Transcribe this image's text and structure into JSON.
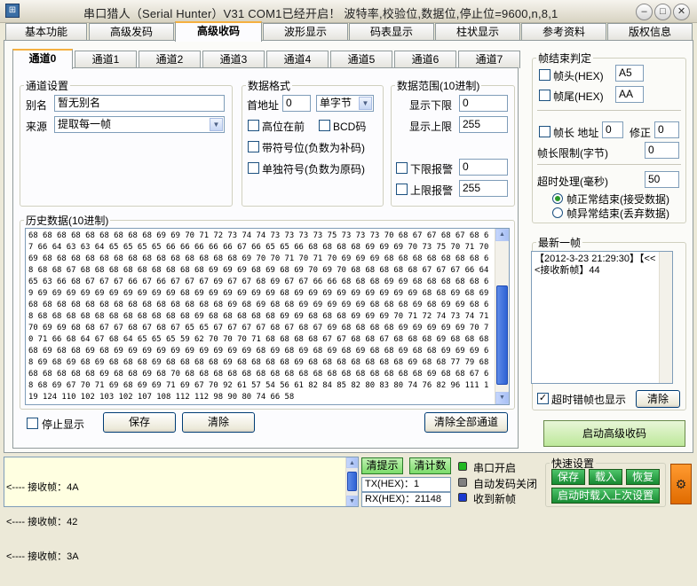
{
  "window": {
    "title": "串口猎人（Serial Hunter）V31    COM1已经开启！ 波特率,校验位,数据位,停止位=9600,n,8,1",
    "icon": "app-icon",
    "min_glyph": "–",
    "max_glyph": "□",
    "close_glyph": "✕"
  },
  "main_tabs": [
    "基本功能",
    "高级发码",
    "高级收码",
    "波形显示",
    "码表显示",
    "柱状显示",
    "参考资料",
    "版权信息"
  ],
  "active_main_tab": "高级收码",
  "channel_tabs": [
    "通道0",
    "通道1",
    "通道2",
    "通道3",
    "通道4",
    "通道5",
    "通道6",
    "通道7"
  ],
  "active_channel_tab": "通道0",
  "channel_settings": {
    "legend": "通道设置",
    "alias_label": "别名",
    "alias_value": "暂无别名",
    "source_label": "来源",
    "source_value": "提取每一帧"
  },
  "data_format": {
    "legend": "数据格式",
    "first_addr_label": "首地址",
    "first_addr_value": "0",
    "byte_value": "单字节",
    "high_first": "高位在前",
    "bcd": "BCD码",
    "signed": "带符号位(负数为补码)",
    "single_sign": "单独符号(负数为原码)"
  },
  "data_range": {
    "legend": "数据范围(10进制)",
    "lower_label": "显示下限",
    "lower_value": "0",
    "upper_label": "显示上限",
    "upper_value": "255",
    "lower_alarm_label": "下限报警",
    "lower_alarm_value": "0",
    "upper_alarm_label": "上限报警",
    "upper_alarm_value": "255"
  },
  "history": {
    "legend": "历史数据(10进制)",
    "data": "68 68 68 68 68 68 68 68 68 69 69 70 71 72 73 74 74 73 73 73 73 75 73 73 73 70 68 67 67 68 67 68 67 66 64 63 63 64 65 65 65 65 66 66 66 66 66 67 66 65 65 66 68 68 68 68 69 69 69 70 73 75 70 71 70 69 68 68 68 68 68 68 68 68 68 68 68 68 68 68 69 70 70 71 70 71 70 69 69 69 68 68 68 68 68 68 68 68 68 68 67 68 68 68 68 68 68 68 68 68 69 69 69 68 69 68 69 70 69 70 68 68 68 68 68 67 67 67 66 64 65 63 66 68 67 67 67 66 67 66 67 67 67 69 67 67 68 69 67 67 66 66 68 68 68 69 69 68 68 68 68 68 69 69 69 69 69 69 69 69 69 69 69 68 69 69 69 69 69 69 68 69 69 69 69 69 69 69 69 69 68 68 69 68 69 68 68 68 68 68 68 68 68 68 68 68 68 68 68 69 68 69 68 68 69 69 69 69 69 68 68 68 69 68 69 69 68 68 68 68 68 68 68 68 68 68 68 68 68 69 68 68 68 68 68 69 69 68 68 68 69 69 69 70 71 72 74 73 74 71 70 69 69 68 68 67 67 68 67 68 67 65 65 67 67 67 67 68 67 68 67 69 68 68 68 68 69 69 69 69 69 70 70 71 66 68 64 67 68 64 65 65 65 59 62 70 70 70 71 68 68 68 68 67 67 68 68 67 68 68 68 69 68 68 68 68 69 68 68 69 68 69 69 69 69 69 69 69 69 69 69 68 69 68 69 68 69 68 69 68 68 69 68 68 69 69 69 68 69 68 69 68 69 68 68 68 69 68 68 68 68 69 68 68 68 68 69 68 68 68 68 68 68 68 69 68 68 77 79 68 68 68 68 68 68 69 68 68 69 68 70 68 68 68 68 68 68 68 68 68 68 68 68 68 68 68 68 68 69 68 68 67 68 68 69 67 70 71 69 68 69 69 71 69 67 70 92 61 57 54 56 61 82 84 85 82 80 83 80 74 76 82 96 111 119 124 110 102 103 102 107 108 112 112 98 90 80 74 66 58"
  },
  "bottom_controls": {
    "stop_display": "停止显示",
    "save": "保存",
    "clear": "清除",
    "clear_all": "清除全部通道"
  },
  "frame_end": {
    "legend": "帧结束判定",
    "head_label": "帧头(HEX)",
    "head_value": "A5",
    "tail_label": "帧尾(HEX)",
    "tail_value": "AA",
    "len_addr_label": "帧长 地址",
    "len_addr_value": "0",
    "correct_label": "修正",
    "correct_value": "0",
    "len_limit_label": "帧长限制(字节)",
    "len_limit_value": "0",
    "timeout_label": "超时处理(毫秒)",
    "timeout_value": "50",
    "opt_normal": "帧正常结束(接受数据)",
    "opt_abnormal": "帧异常结束(丢弃数据)"
  },
  "latest_frame": {
    "legend": "最新一帧",
    "text": "【2012-3-23 21:29:30】【<<<接收新帧】44",
    "show_timeout": "超时错帧也显示",
    "clear": "清除"
  },
  "start_button": "启动高级收码",
  "log": {
    "lines": [
      "<---- 接收帧：4A",
      "<---- 接收帧：42",
      "<---- 接收帧：3A"
    ]
  },
  "status": {
    "clear_tip": "清提示",
    "clear_count": "清计数",
    "tx": "TX(HEX)：1",
    "rx": "RX(HEX)：21148",
    "port_open": "串口开启",
    "auto_send_off": "自动发码关闭",
    "recv_new_frame": "收到新帧",
    "colors": {
      "port_open": "#22b822",
      "auto_send_off": "#808080",
      "recv_new_frame": "#1a3ad0"
    }
  },
  "quick_settings": {
    "legend": "快速设置",
    "save": "保存",
    "load": "载入",
    "restore": "恢复",
    "autoload": "启动时载入上次设置"
  },
  "tool_icon": "tool-icon"
}
